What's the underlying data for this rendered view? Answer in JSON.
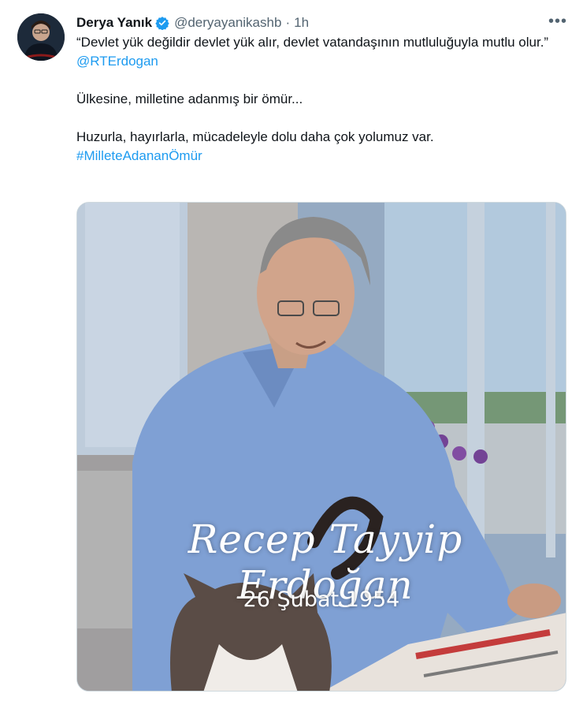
{
  "author": {
    "name": "Derya Yanık",
    "handle": "@deryayanikashb",
    "separator": "·",
    "time": "1h",
    "more_label": "•••"
  },
  "tweet": {
    "line1": "“Devlet yük değildir devlet yük alır, devlet vatandaşının mutluluğuyla mutlu olur.”",
    "mention": "@RTErdogan",
    "line2": "Ülkesine, milletine adanmış bir ömür...",
    "line3": "Huzurla, hayırlarla, mücadeleyle dolu daha çok yolumuz var.",
    "hashtag": "#MilleteAdananÖmür"
  },
  "media": {
    "caption_name": "Recep Tayyip Erdoğan",
    "caption_date": "26 Şubat 1954"
  },
  "colors": {
    "link": "#1d9bf0",
    "verified": "#1d9bf0",
    "muted": "#536471"
  },
  "icons": {
    "verified": "verified-badge-icon",
    "more": "more-icon"
  }
}
